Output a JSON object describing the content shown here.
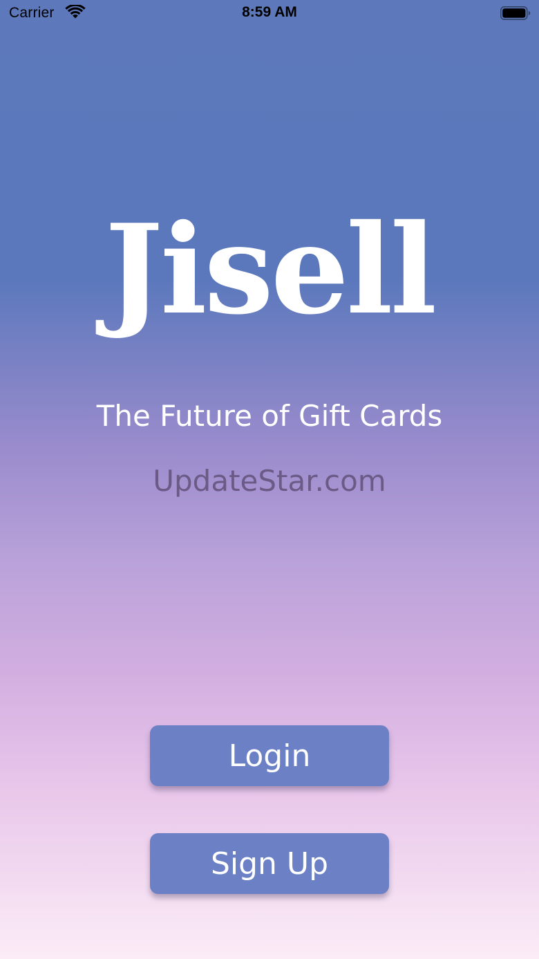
{
  "status_bar": {
    "carrier": "Carrier",
    "time": "8:59 AM",
    "wifi_icon": "wifi-icon",
    "battery_icon": "battery-icon"
  },
  "branding": {
    "logo_text": "Jisell",
    "tagline": "The Future of Gift Cards",
    "watermark": "UpdateStar.com"
  },
  "actions": {
    "login_label": "Login",
    "signup_label": "Sign Up"
  },
  "colors": {
    "gradient_top": "#5d79bc",
    "gradient_bottom": "#fbecf6",
    "button_bg": "#6b80c5",
    "text": "#ffffff"
  }
}
